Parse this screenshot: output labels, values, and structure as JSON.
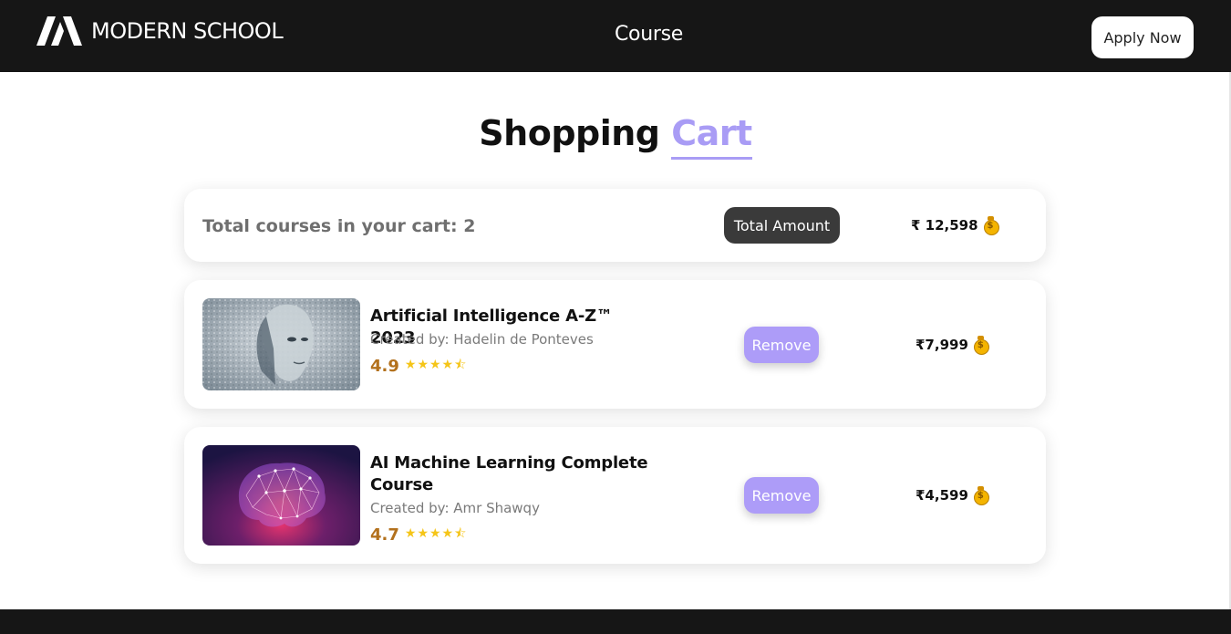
{
  "header": {
    "brand_name": "MODERN SCHOOL",
    "nav_course": "Course",
    "apply_label": "Apply Now"
  },
  "page": {
    "title_main": "Shopping",
    "title_accent": "Cart",
    "accent_color": "#a99cf5"
  },
  "summary": {
    "text": "Total courses in your cart: 2",
    "total_label": "Total Amount",
    "total_amount": "₹ 12,598"
  },
  "items": [
    {
      "title": "Artificial Intelligence A-Z™ 2023",
      "author": "Created by: Hadelin de Ponteves",
      "rating": "4.9",
      "stars": "★★★★⯪",
      "remove_label": "Remove",
      "price": "₹7,999",
      "image": "ai-face-image"
    },
    {
      "title": "AI Machine Learning Complete Course",
      "author": "Created by: Amr Shawqy",
      "rating": "4.7",
      "stars": "★★★★⯪",
      "remove_label": "Remove",
      "price": "₹4,599",
      "image": "glowing-brain-image"
    }
  ],
  "icons": {
    "brand": "brand-logo-icon",
    "money": "money-bag-icon",
    "star": "star-icon"
  },
  "colors": {
    "header_bg": "#161616",
    "remove_button": "#ad9cf8",
    "rating": "#b3711d",
    "stars": "#f5c518"
  }
}
